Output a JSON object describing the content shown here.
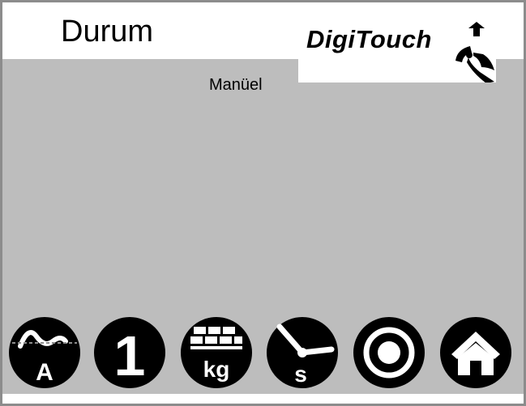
{
  "header": {
    "title": "Durum",
    "logo_text": "DigiTouch"
  },
  "main": {
    "mode_label": "Manüel"
  },
  "toolbar": {
    "buttons": [
      {
        "icon": "ac-current-icon",
        "badge": "A"
      },
      {
        "icon": "channel-1-icon",
        "badge": "1"
      },
      {
        "icon": "weight-kg-icon",
        "badge": "kg"
      },
      {
        "icon": "timer-seconds-icon",
        "badge": "s"
      },
      {
        "icon": "target-icon"
      },
      {
        "icon": "home-icon"
      }
    ]
  },
  "colors": {
    "background": "#bdbdbd",
    "header": "#ffffff",
    "button": "#000000",
    "icon": "#ffffff",
    "frame": "#8c8c8c"
  }
}
